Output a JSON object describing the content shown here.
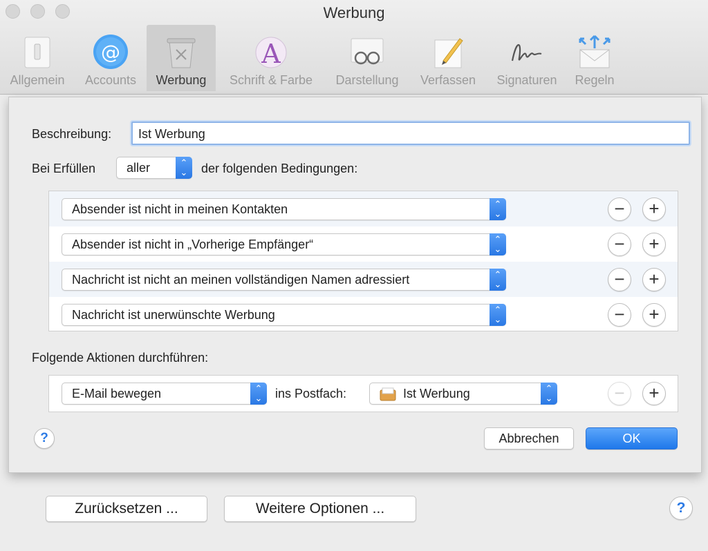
{
  "window": {
    "title": "Werbung"
  },
  "toolbar": {
    "tabs": [
      {
        "label": "Allgemein",
        "icon": "switch-icon"
      },
      {
        "label": "Accounts",
        "icon": "at-icon"
      },
      {
        "label": "Werbung",
        "icon": "trash-junk-icon",
        "active": true
      },
      {
        "label": "Schrift & Farbe",
        "icon": "font-color-icon"
      },
      {
        "label": "Darstellung",
        "icon": "glasses-icon"
      },
      {
        "label": "Verfassen",
        "icon": "pencil-icon"
      },
      {
        "label": "Signaturen",
        "icon": "signature-icon"
      },
      {
        "label": "Regeln",
        "icon": "rules-envelope-icon"
      }
    ]
  },
  "sheet": {
    "description_label": "Beschreibung:",
    "description_value": "Ist Werbung",
    "match_prefix": "Bei Erfüllen",
    "match_value": "aller",
    "match_suffix": "der folgenden Bedingungen:",
    "conditions": [
      "Absender ist nicht in meinen Kontakten",
      "Absender ist nicht in „Vorherige Empfänger“",
      "Nachricht ist nicht an meinen vollständigen Namen adressiert",
      "Nachricht ist unerwünschte Werbung"
    ],
    "actions_label": "Folgende Aktionen durchführen:",
    "action": {
      "verb": "E-Mail bewegen",
      "connector": "ins Postfach:",
      "mailbox": "Ist Werbung"
    },
    "cancel_label": "Abbrechen",
    "ok_label": "OK",
    "help_glyph": "?"
  },
  "footer": {
    "reset_label": "Zurücksetzen ...",
    "more_options_label": "Weitere Optionen ...",
    "help_glyph": "?"
  },
  "colors": {
    "accent": "#2a78e4",
    "focus": "#8db4e8"
  }
}
